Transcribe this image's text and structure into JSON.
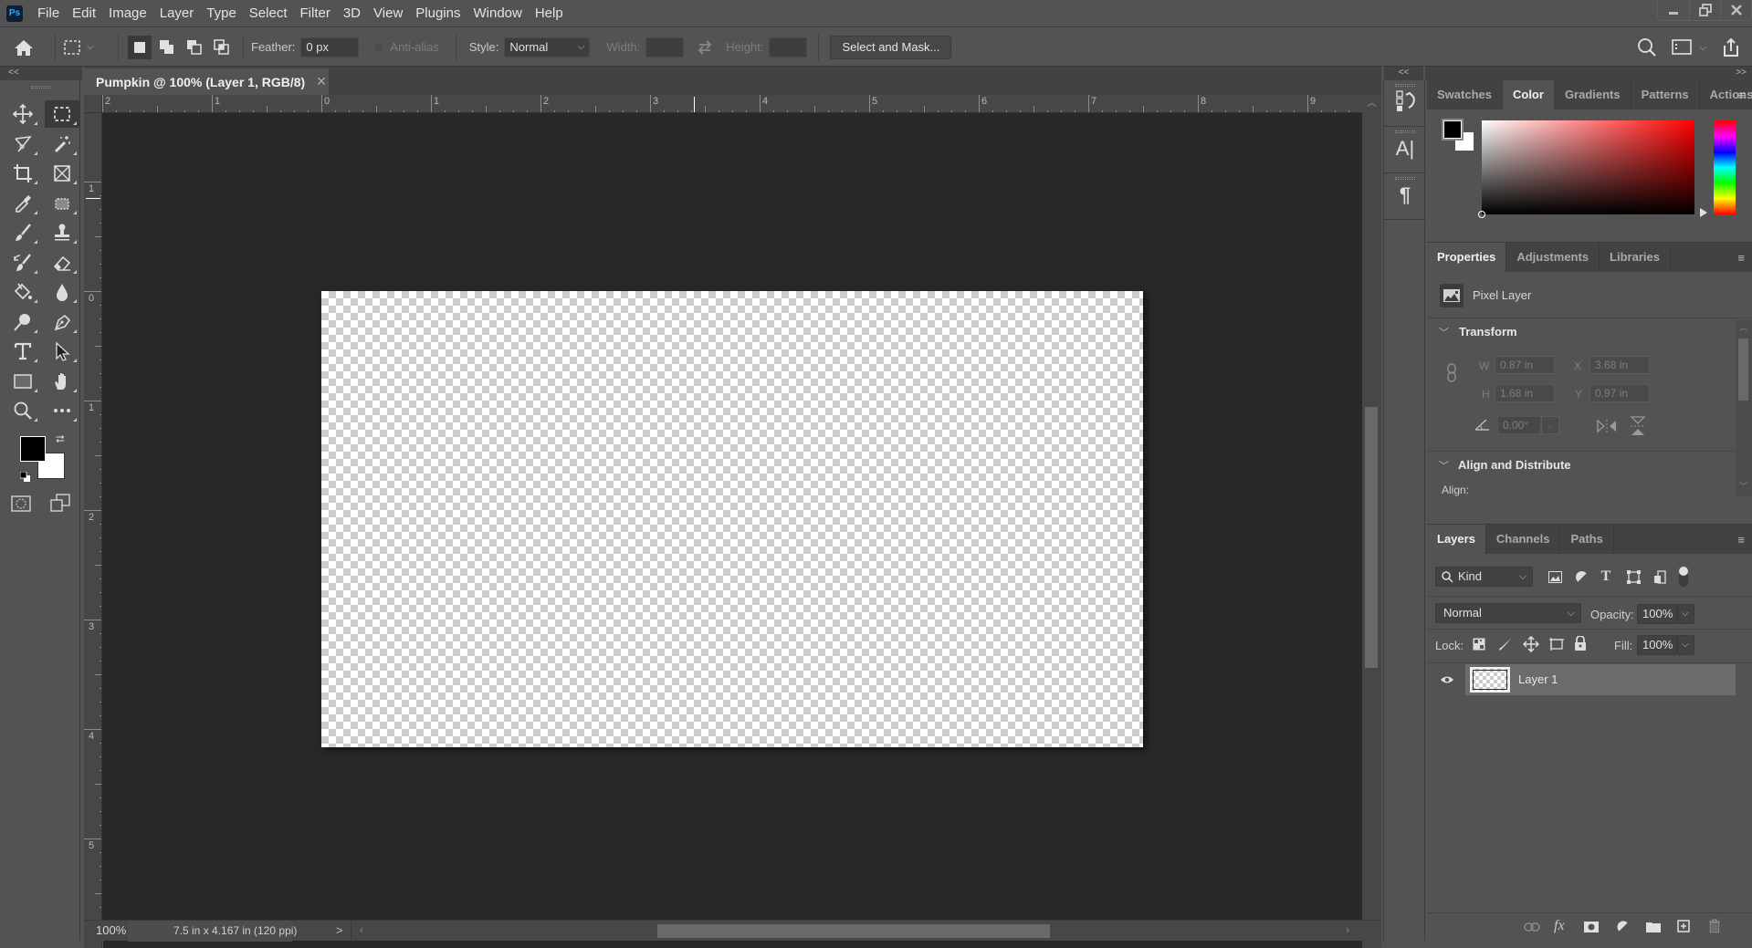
{
  "app": {
    "logo": "Ps",
    "menu": [
      "File",
      "Edit",
      "Image",
      "Layer",
      "Type",
      "Select",
      "Filter",
      "3D",
      "View",
      "Plugins",
      "Window",
      "Help"
    ],
    "window_buttons": {
      "minimize": "minimize-icon",
      "restore": "restore-icon",
      "close": "close-icon"
    }
  },
  "options_bar": {
    "home_icon": "home-icon",
    "tool_preset_icon": "rectangular-marquee-icon",
    "selection_modes": [
      "new-selection",
      "add-to-selection",
      "subtract-from-selection",
      "intersect-with-selection"
    ],
    "active_mode": "new-selection",
    "feather_label": "Feather:",
    "feather_value": "0 px",
    "antialias_label": "Anti-alias",
    "antialias_checked": false,
    "style_label": "Style:",
    "style_value": "Normal",
    "width_label": "Width:",
    "width_value": "",
    "height_label": "Height:",
    "height_value": "",
    "select_and_mask_label": "Select and Mask...",
    "right_icons": [
      "search-icon",
      "workspace-icon",
      "share-icon"
    ]
  },
  "toolbox": {
    "collapse": "<<",
    "tools": [
      [
        "move",
        "rectangular-marquee"
      ],
      [
        "lasso",
        "magic-wand"
      ],
      [
        "crop",
        "frame"
      ],
      [
        "eyedropper",
        "spot-healing"
      ],
      [
        "brush",
        "clone-stamp"
      ],
      [
        "history-brush",
        "eraser"
      ],
      [
        "paint-bucket",
        "blur"
      ],
      [
        "dodge",
        "pen"
      ],
      [
        "type",
        "path-selection"
      ],
      [
        "rectangle",
        "hand"
      ],
      [
        "zoom",
        "edit-toolbar"
      ]
    ],
    "active_tool": "rectangular-marquee",
    "foreground_color": "#000000",
    "background_color": "#ffffff"
  },
  "document": {
    "tab_title": "Pumpkin @ 100% (Layer 1, RGB/8)",
    "hruler_labels": [
      "2",
      "1",
      "0",
      "1",
      "2",
      "3",
      "4",
      "5",
      "6",
      "7",
      "8",
      "9"
    ],
    "vruler_labels": [
      "1",
      "0",
      "1",
      "2",
      "3",
      "4",
      "5"
    ],
    "zoom": "100%",
    "doc_info": "7.5 in x 4.167 in (120 ppi)",
    "status_arrow": ">"
  },
  "dock_strip": {
    "collapse": "<<",
    "items": [
      "history-icon",
      "character-icon",
      "paragraph-icon"
    ]
  },
  "panels": {
    "expand": ">>",
    "color_panel": {
      "tabs": [
        "Swatches",
        "Color",
        "Gradients",
        "Patterns",
        "Actions"
      ],
      "active_tab": "Color",
      "foreground": "#000000",
      "background": "#ffffff",
      "hue_color": "#ff0000"
    },
    "properties_panel": {
      "tabs": [
        "Properties",
        "Adjustments",
        "Libraries"
      ],
      "active_tab": "Properties",
      "layer_type": "Pixel Layer",
      "transform_header": "Transform",
      "w_label": "W",
      "w_value": "0.87 in",
      "h_label": "H",
      "h_value": "1.68 in",
      "x_label": "X",
      "x_value": "3.68 in",
      "y_label": "Y",
      "y_value": "0.97 in",
      "angle_value": "0.00°",
      "align_header": "Align and Distribute",
      "align_label": "Align:"
    },
    "layers_panel": {
      "tabs": [
        "Layers",
        "Channels",
        "Paths"
      ],
      "active_tab": "Layers",
      "filter_kind": "Kind",
      "blend_mode": "Normal",
      "opacity_label": "Opacity:",
      "opacity_value": "100%",
      "lock_label": "Lock:",
      "fill_label": "Fill:",
      "fill_value": "100%",
      "layers": [
        {
          "name": "Layer 1",
          "visible": true,
          "selected": true
        }
      ],
      "footer_icons": [
        "link-layers-icon",
        "fx-icon",
        "add-mask-icon",
        "adjustment-layer-icon",
        "new-group-icon",
        "new-layer-icon",
        "delete-layer-icon"
      ]
    }
  }
}
